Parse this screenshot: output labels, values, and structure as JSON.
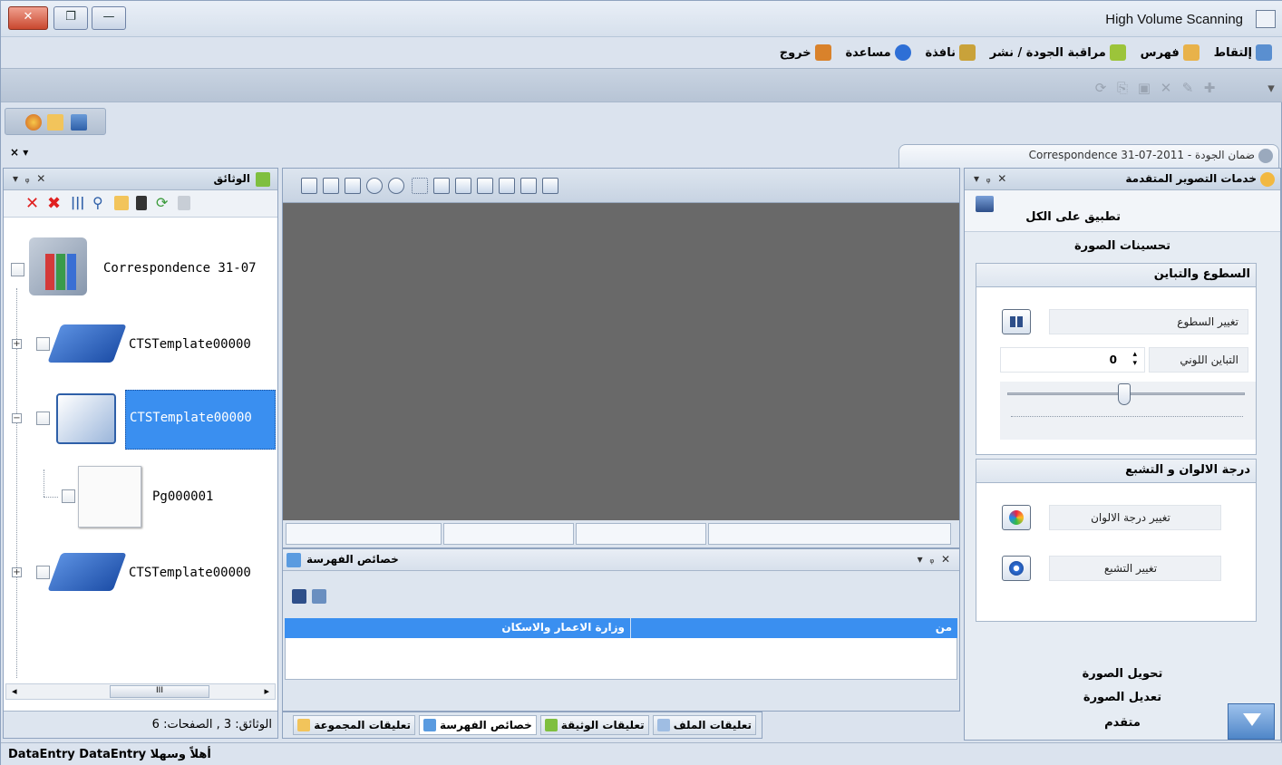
{
  "window": {
    "title": "High Volume Scanning",
    "close": "✕",
    "restore": "❐",
    "minimize": "—"
  },
  "menu": [
    {
      "label": "إلتقاط",
      "icon": "scanner-icon",
      "color": "#5a8fd0"
    },
    {
      "label": "فهرس",
      "icon": "edit-note-icon",
      "color": "#e8b24a"
    },
    {
      "label": "مراقبة الجودة / نشر",
      "icon": "quality-icon",
      "color": "#9cc43a"
    },
    {
      "label": "نافذة",
      "icon": "window-icon",
      "color": "#c9a23a"
    },
    {
      "label": "مساعدة",
      "icon": "help-icon",
      "color": "#2e6fd6"
    },
    {
      "label": "خروج",
      "icon": "exit-door-icon",
      "color": "#d9822b"
    }
  ],
  "tab": {
    "label": "Correspondence 31-07-2011 - ضمان الجودة"
  },
  "close_x": "× ▾",
  "documents_panel": {
    "title": "الوثائق",
    "tree": [
      {
        "label": "Correspondence 31-07",
        "kind": "folder"
      },
      {
        "label": "CTSTemplate00000",
        "kind": "batch"
      },
      {
        "label": "CTSTemplate00000",
        "kind": "open-batch",
        "selected": true
      },
      {
        "label": "Pg000001",
        "kind": "page"
      },
      {
        "label": "CTSTemplate00000",
        "kind": "batch"
      }
    ],
    "scroll_thumb": "III",
    "status": "الوثائق: 3 , الصفحات: 6"
  },
  "index_panel": {
    "title": "خصائص الفهرسة",
    "row_label": "من",
    "row_value": "وزارة الاعمار والاسكان"
  },
  "bottom_tabs": [
    "تعليقات الملف",
    "تعليقات الوثيقة",
    "خصائص الفهرسة",
    "تعليقات المجموعة"
  ],
  "right_panel": {
    "title": "خدمات التصوير المتقدمة",
    "apply_all": "تطبيق على الكل",
    "enhancements": "تحسينات الصورة",
    "brightness_section": "السطوع والتباين",
    "change_brightness": "تغيير السطوع",
    "contrast_label": "التباين اللوني",
    "contrast_value": "0",
    "color_section": "درجة الالوان و التشبع",
    "change_hue": "تغيير درجة الالوان",
    "change_saturation": "تغيير التشبع",
    "convert": "تحويل الصورة",
    "edit": "تعديل الصورة",
    "advanced": "متقدم"
  },
  "status_bar": {
    "welcome": "أهلاً وسهلا",
    "user": "DataEntry DataEntry"
  }
}
